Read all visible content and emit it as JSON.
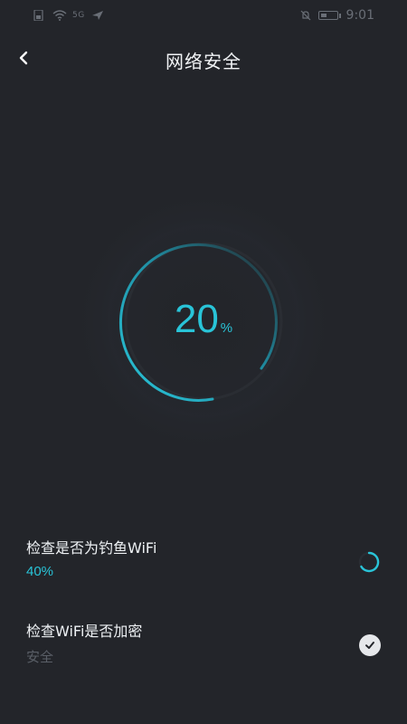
{
  "status_bar": {
    "network": "5G",
    "time": "9:01"
  },
  "header": {
    "title": "网络安全",
    "back_icon": "chevron-left-icon"
  },
  "progress": {
    "value": 20,
    "value_text": "20",
    "unit": "%",
    "accent": "#29c4d8"
  },
  "checks": [
    {
      "title": "检查是否为钓鱼WiFi",
      "status": "40%",
      "state": "in-progress",
      "icon": "spinner-icon"
    },
    {
      "title": "检查WiFi是否加密",
      "status": "安全",
      "state": "done",
      "icon": "checkmark-icon"
    }
  ],
  "colors": {
    "background": "#23252a",
    "accent": "#29c4d8",
    "muted": "#5a5f67",
    "text": "#eef1f4"
  }
}
